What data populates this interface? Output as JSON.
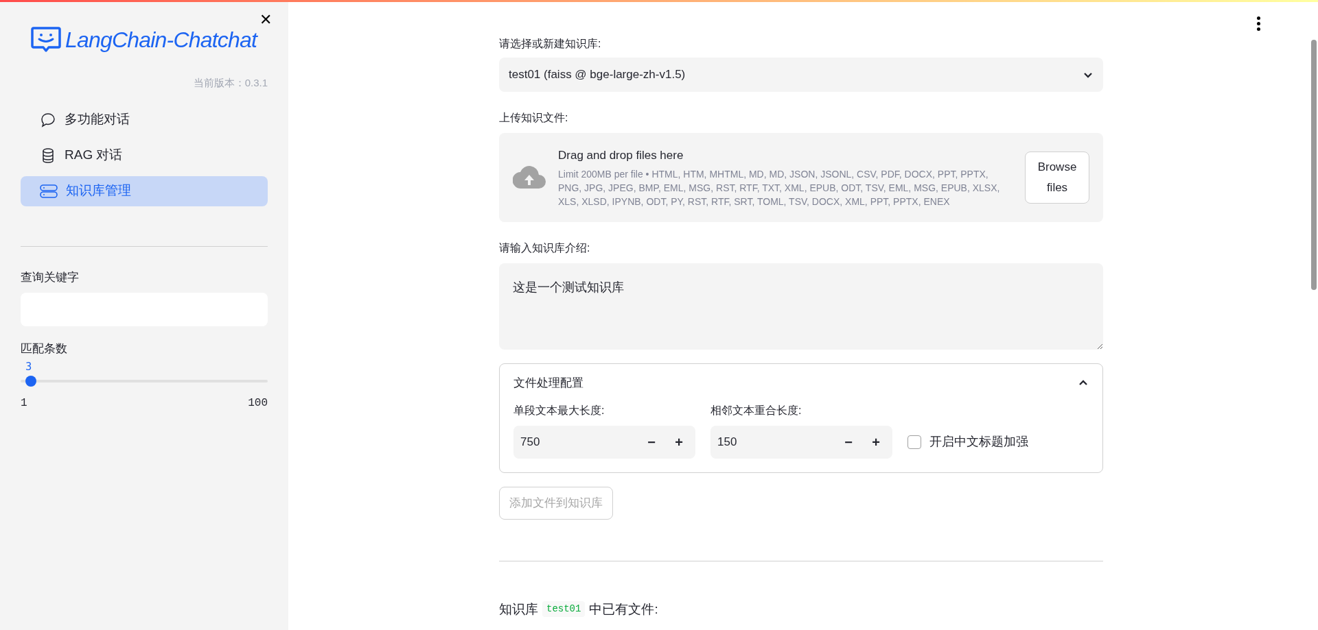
{
  "sidebar": {
    "logo_text": "LangChain-Chatchat",
    "close": "✕",
    "version": "当前版本：0.3.1",
    "nav": [
      {
        "label": "多功能对话",
        "kind": "chat",
        "selected": false
      },
      {
        "label": "RAG 对话",
        "kind": "database",
        "selected": false
      },
      {
        "label": "知识库管理",
        "kind": "storage",
        "selected": true
      }
    ],
    "search": {
      "label": "查询关键字"
    },
    "slider": {
      "label": "匹配条数",
      "reading": "3",
      "level": 0.0202,
      "min": "1",
      "max": "100"
    }
  },
  "main": {
    "kb_select": {
      "label": "请选择或新建知识库:",
      "value": "test01 (faiss @ bge-large-zh-v1.5)"
    },
    "upload": {
      "label": "上传知识文件:",
      "title": "Drag and drop files here",
      "hint": "Limit 200MB per file • HTML, HTM, MHTML, MD, MD, JSON, JSONL, CSV, PDF, DOCX, PPT, PPTX, PNG, JPG, JPEG, BMP, EML, MSG, RST, RTF, TXT, XML, EPUB, ODT, TSV, EML, MSG, EPUB, XLSX, XLS, XLSD, IPYNB, ODT, PY, RST, RTF, SRT, TOML, TSV, DOCX, XML, PPT, PPTX, ENEX",
      "button": "Browse files"
    },
    "intro": {
      "label": "请输入知识库介绍:",
      "value": "这是一个测试知识库"
    },
    "config": {
      "title": "文件处理配置",
      "expanded": true,
      "numbers": [
        {
          "label": "单段文本最大长度:",
          "value": "750",
          "minus": "−",
          "plus": "+"
        },
        {
          "label": "相邻文本重合长度:",
          "value": "150",
          "minus": "−",
          "plus": "+"
        }
      ],
      "checkbox": {
        "label": "开启中文标题加强",
        "checked": false
      }
    },
    "add_button": {
      "label": "添加文件到知识库",
      "disabled": true
    },
    "files_heading": {
      "before": "知识库",
      "code": "test01",
      "after": "中已有文件:"
    }
  }
}
